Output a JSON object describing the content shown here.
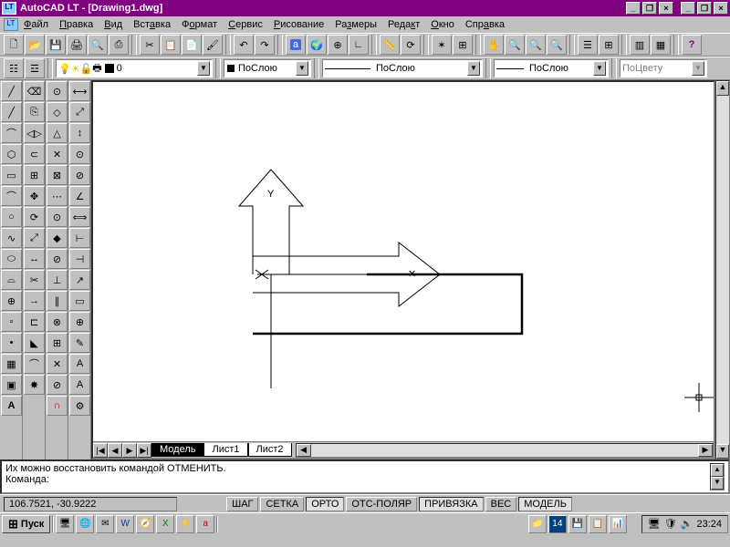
{
  "title": {
    "app": "AutoCAD LT",
    "doc": "[Drawing1.dwg]"
  },
  "menu": {
    "file": "Файл",
    "edit": "Правка",
    "view": "Вид",
    "insert": "Вставка",
    "format": "Формат",
    "tools": "Сервис",
    "draw": "Рисование",
    "dimension": "Размеры",
    "modify": "Редакт",
    "window": "Окно",
    "help": "Справка"
  },
  "dropdowns": {
    "layer": "0",
    "color": "ПоСлою",
    "linetype": "ПоСлою",
    "lineweight": "ПоСлою",
    "bycolor": "ПоЦвету"
  },
  "tabs": {
    "model": "Модель",
    "sheet1": "Лист1",
    "sheet2": "Лист2"
  },
  "command": {
    "line1": "Их можно восстановить командой ОТМЕНИТЬ.",
    "line2": "Команда:"
  },
  "status": {
    "coords": "106.7521, -30.9222",
    "snap": "ШАГ",
    "grid": "СЕТКА",
    "ortho": "ОРТО",
    "polar": "ОТС-ПОЛЯР",
    "osnap": "ПРИВЯЗКА",
    "lwt": "ВЕС",
    "model": "МОДЕЛЬ"
  },
  "taskbar": {
    "start": "Пуск",
    "time": "23:24"
  }
}
